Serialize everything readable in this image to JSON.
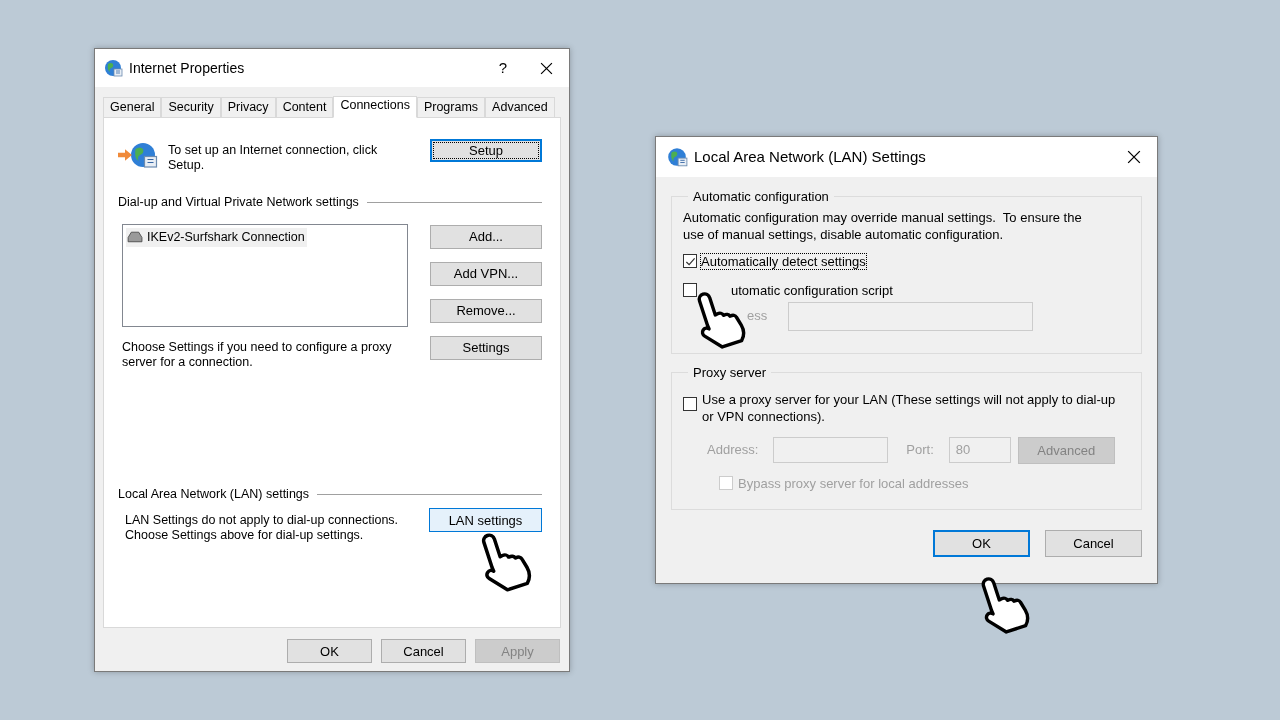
{
  "internet_properties": {
    "title": "Internet Properties",
    "help": "?",
    "tabs": [
      {
        "label": "General",
        "selected": false
      },
      {
        "label": "Security",
        "selected": false
      },
      {
        "label": "Privacy",
        "selected": false
      },
      {
        "label": "Content",
        "selected": false
      },
      {
        "label": "Connections",
        "selected": true
      },
      {
        "label": "Programs",
        "selected": false
      },
      {
        "label": "Advanced",
        "selected": false
      }
    ],
    "setup_text": "To set up an Internet connection, click Setup.",
    "setup_button": {
      "label": "Setup",
      "focused": true
    },
    "vpn_section": "Dial-up and Virtual Private Network settings",
    "connections": [
      {
        "name": "IKEv2-Surfshark Connection",
        "selected": true
      }
    ],
    "side_buttons": [
      "Add...",
      "Add VPN...",
      "Remove...",
      "Settings"
    ],
    "proxy_text": "Choose Settings if you need to configure a proxy server for a connection.",
    "lan_section": "Local Area Network (LAN) settings",
    "lan_text": "LAN Settings do not apply to dial-up connections. Choose Settings above for dial-up settings.",
    "lan_button": {
      "label": "LAN settings",
      "hovered": true
    },
    "footer_buttons": [
      {
        "label": "OK",
        "disabled": false
      },
      {
        "label": "Cancel",
        "disabled": false
      },
      {
        "label": "Apply",
        "disabled": true
      }
    ]
  },
  "lan_dialog": {
    "title": "Local Area Network (LAN) Settings",
    "auto_section": "Automatic configuration",
    "auto_text": "Automatic configuration may override manual settings.  To ensure the use of manual settings, disable automatic configuration.",
    "options": [
      {
        "label": "Automatically detect settings",
        "checked": true,
        "focused": true
      },
      {
        "label": "utomatic configuration script",
        "checked": false,
        "focused": false
      }
    ],
    "script_address": {
      "label": "ess",
      "disabled": true
    },
    "proxy_section": "Proxy server",
    "proxy_option": {
      "label": "Use a proxy server for your LAN (These settings will not apply to dial-up or VPN connections).",
      "checked": false
    },
    "address_label": "Address:",
    "port_label": "Port:",
    "port_value": "80",
    "advanced_button": {
      "label": "Advanced",
      "disabled": true
    },
    "bypass": {
      "label": "Bypass proxy server for local addresses",
      "checked": false,
      "disabled": true
    },
    "buttons": [
      {
        "label": "OK",
        "default": true
      },
      {
        "label": "Cancel",
        "default": false
      }
    ]
  }
}
